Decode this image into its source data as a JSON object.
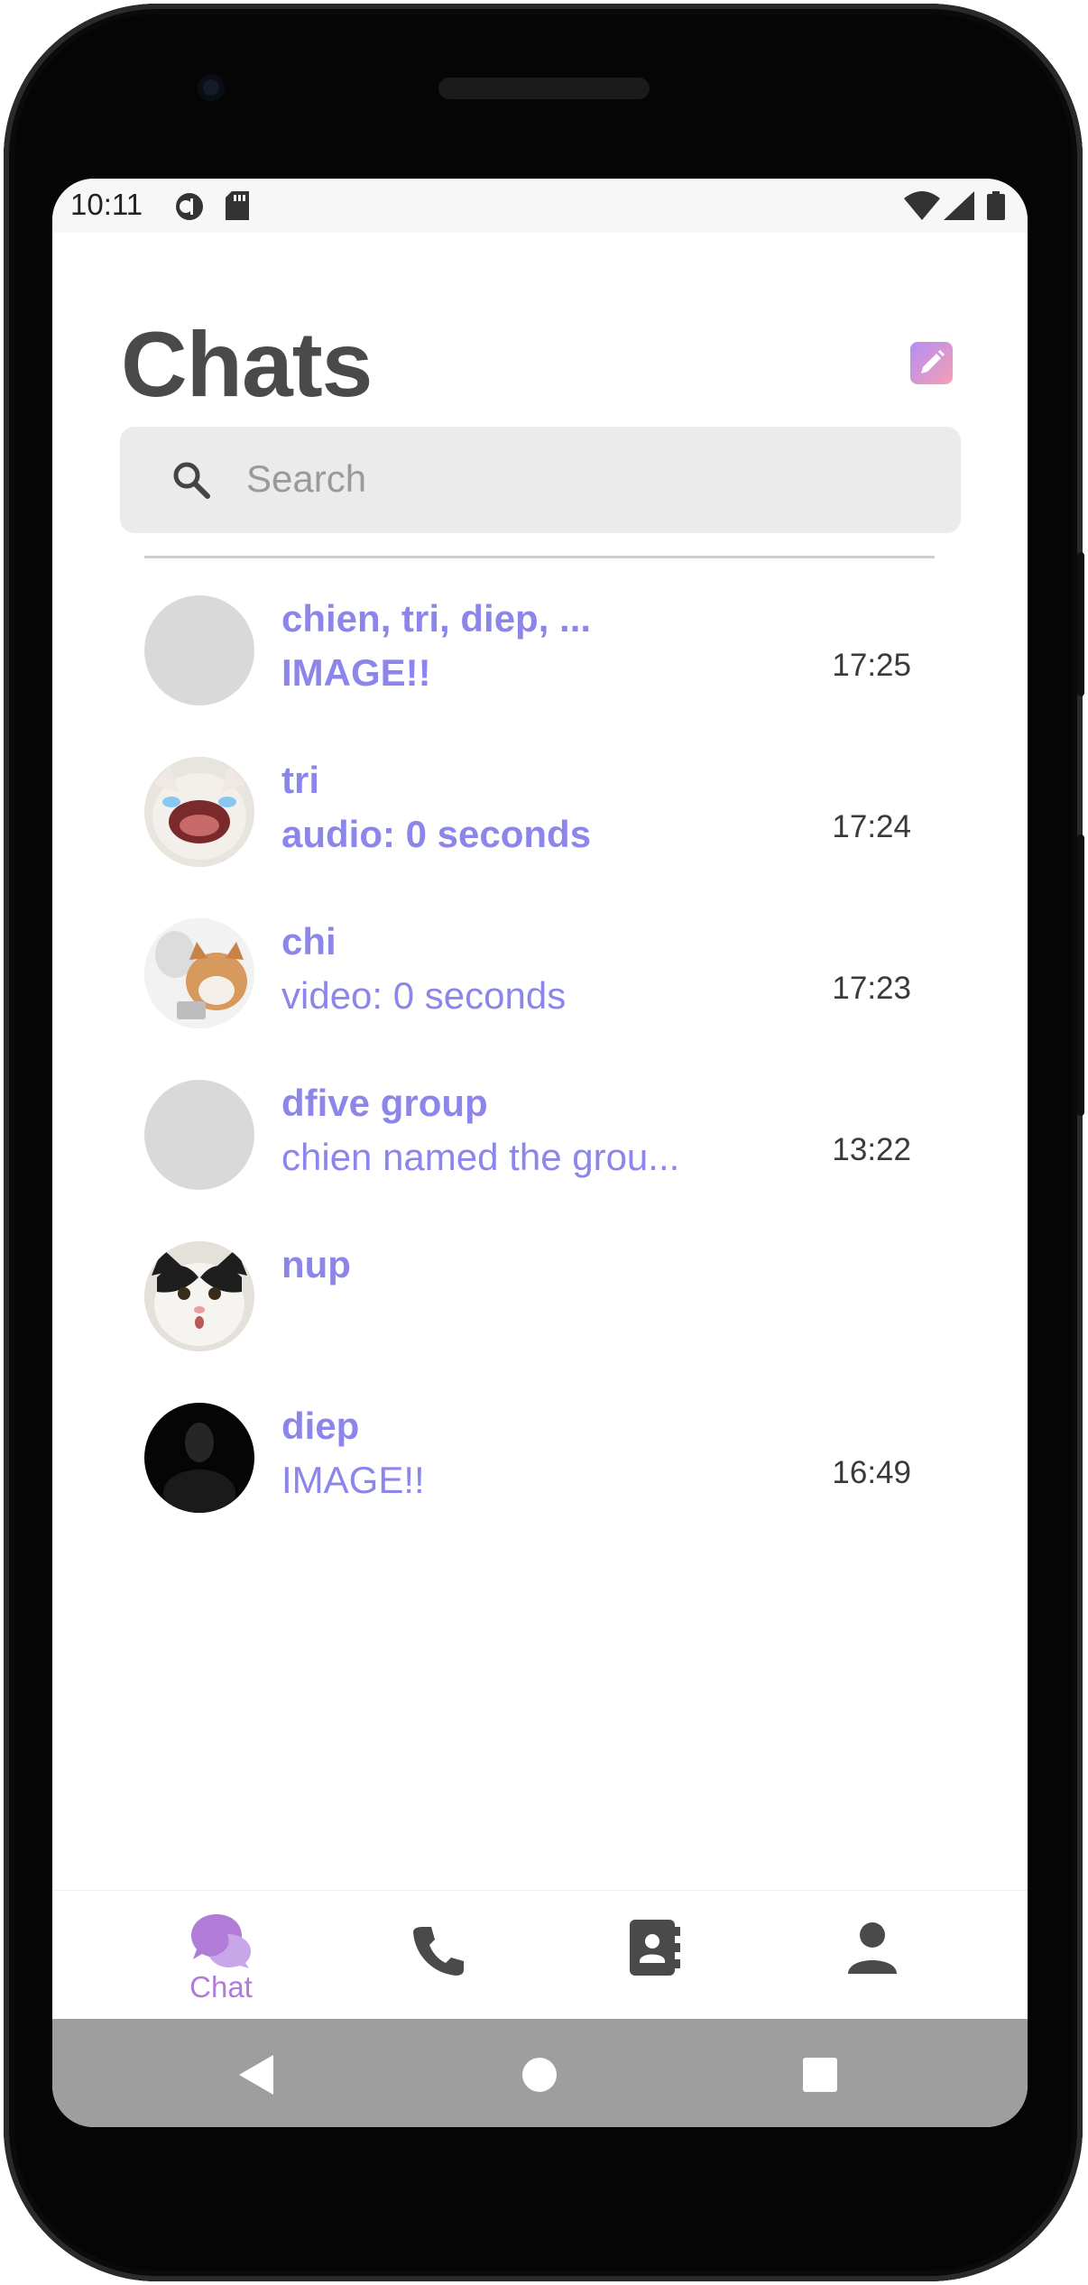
{
  "status_bar": {
    "time": "10:11"
  },
  "header": {
    "title": "Chats"
  },
  "search": {
    "placeholder": "Search"
  },
  "chats": [
    {
      "name": "chien, tri, diep, ...",
      "message": "IMAGE!!",
      "time": "17:25",
      "unread": true,
      "avatar": "placeholder"
    },
    {
      "name": "tri",
      "message": "audio: 0 seconds",
      "time": "17:24",
      "unread": true,
      "avatar": "cat-crying-photo"
    },
    {
      "name": "chi",
      "message": "video: 0 seconds",
      "time": "17:23",
      "unread": false,
      "avatar": "cat-laptop-photo"
    },
    {
      "name": "dfive group",
      "message": "chien named the grou...",
      "time": "13:22",
      "unread": false,
      "avatar": "placeholder"
    },
    {
      "name": "nup",
      "message": "",
      "time": "",
      "unread": false,
      "avatar": "cat-surprised-photo"
    },
    {
      "name": "diep",
      "message": "IMAGE!!",
      "time": "16:49",
      "unread": false,
      "avatar": "dark-silhouette"
    }
  ],
  "bottom_nav": {
    "items": [
      {
        "label": "Chat",
        "icon": "chat-bubbles-icon",
        "active": true
      },
      {
        "label": "",
        "icon": "phone-icon",
        "active": false
      },
      {
        "label": "",
        "icon": "contacts-book-icon",
        "active": false
      },
      {
        "label": "",
        "icon": "person-icon",
        "active": false
      }
    ]
  },
  "colors": {
    "accent": "#8d86ea",
    "nav_active": "#b07cd8",
    "nav_inactive": "#4a4a4a",
    "title": "#4a4a4a",
    "search_bg": "#ebebeb"
  }
}
